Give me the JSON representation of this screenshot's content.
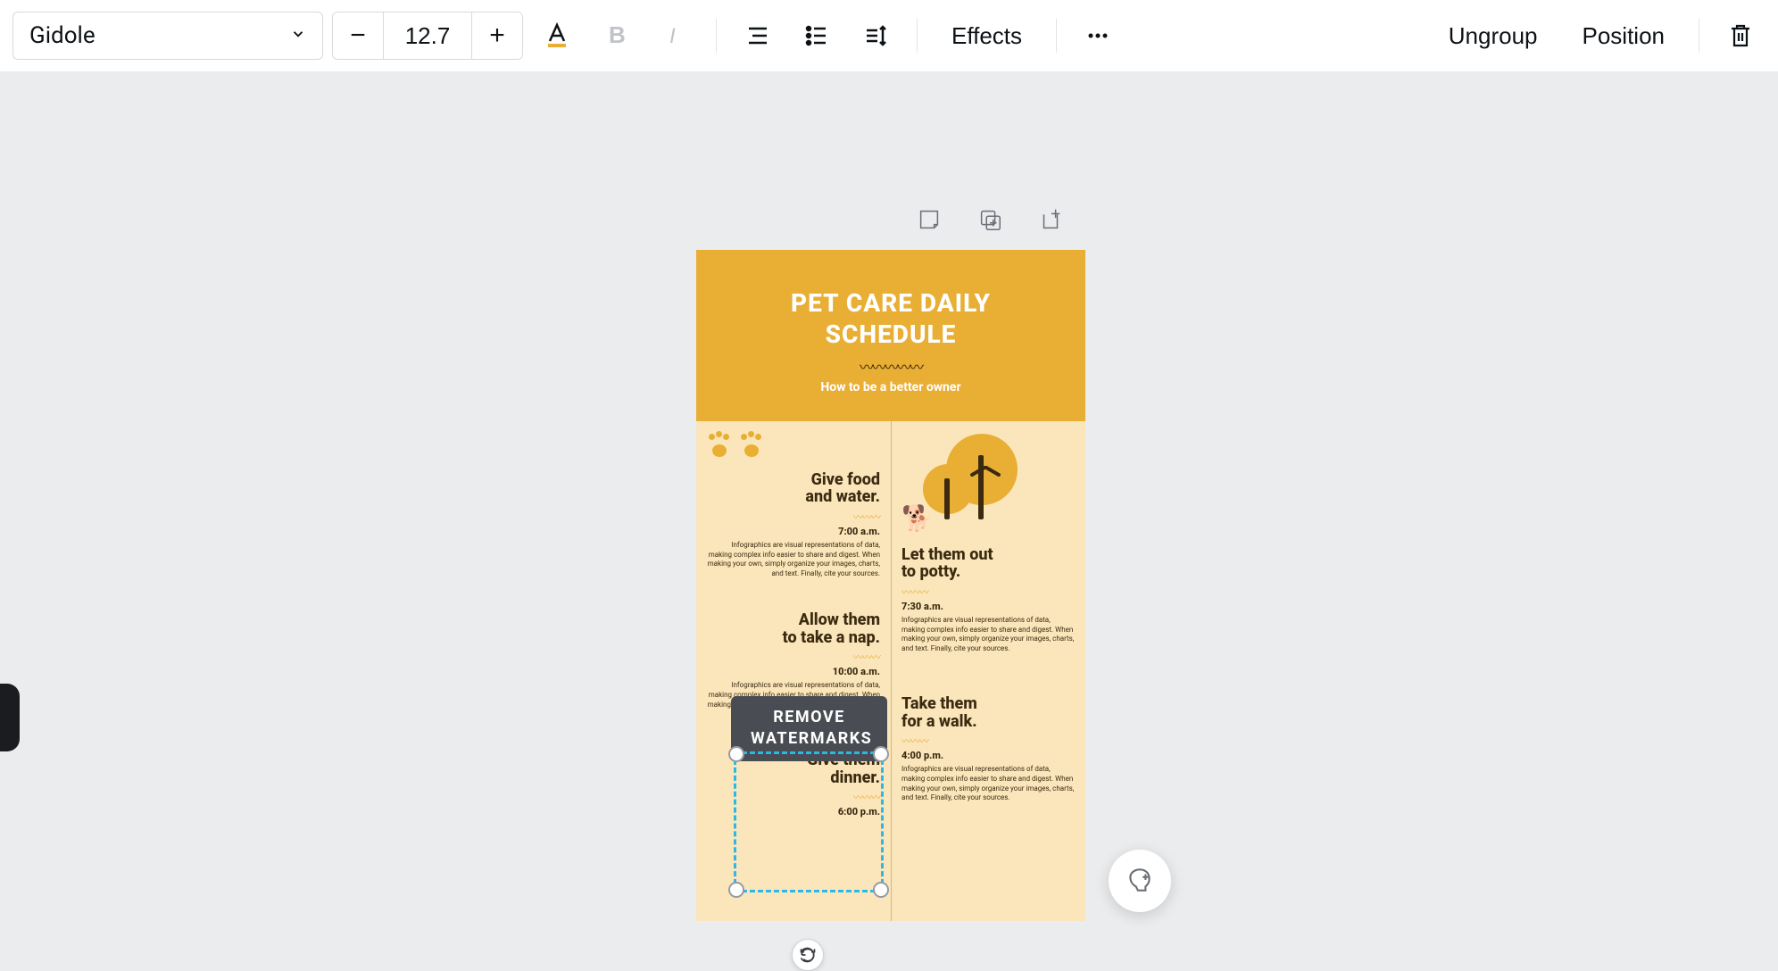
{
  "toolbar": {
    "font_name": "Gidole",
    "font_size": "12.7",
    "effects_label": "Effects",
    "ungroup_label": "Ungroup",
    "position_label": "Position"
  },
  "design": {
    "title_line1": "PET CARE DAILY",
    "title_line2": "SCHEDULE",
    "subtitle": "How to be a better owner",
    "items": [
      {
        "title_l1": "Give food",
        "title_l2": "and water.",
        "time": "7:00 a.m.",
        "desc": "Infographics are visual representations of data, making complex info easier to share and digest. When making your own, simply organize your images, charts, and text. Finally, cite your sources."
      },
      {
        "title_l1": "Let them out",
        "title_l2": "to potty.",
        "time": "7:30 a.m.",
        "desc": "Infographics are visual representations of data, making complex info easier to share and digest. When making your own, simply organize your images, charts, and text. Finally, cite your sources."
      },
      {
        "title_l1": "Allow them",
        "title_l2": "to take a nap.",
        "time": "10:00 a.m.",
        "desc": "Infographics are visual representations of data, making complex info easier to share and digest. When making your own, simply organize your images, charts, and text. Finally, cite your sources."
      },
      {
        "title_l1": "Take them",
        "title_l2": "for a walk.",
        "time": "4:00 p.m.",
        "desc": "Infographics are visual representations of data, making complex info easier to share and digest. When making your own, simply organize your images, charts, and text. Finally, cite your sources."
      },
      {
        "title_l1": "Give them",
        "title_l2": "dinner.",
        "time": "6:00 p.m.",
        "desc": ""
      }
    ]
  },
  "watermark_tip": {
    "line1": "REMOVE",
    "line2": "WATERMARKS"
  }
}
